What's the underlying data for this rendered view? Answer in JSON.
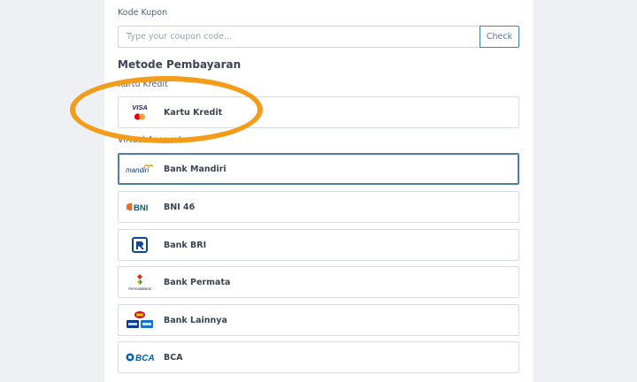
{
  "coupon": {
    "label": "Kode Kupon",
    "placeholder": "Type your coupon code...",
    "value": "",
    "check_label": "Check"
  },
  "payment": {
    "title": "Metode Pembayaran",
    "credit_card_section": "Kartu Kredit",
    "virtual_account_section": "Virtual Account",
    "credit_card": {
      "label": "Kartu Kredit",
      "logo_text": "VISA"
    },
    "banks": [
      {
        "label": "Bank Mandiri",
        "logo_text": "mandiri",
        "selected": true
      },
      {
        "label": "BNI 46",
        "logo_text": "BNI",
        "selected": false
      },
      {
        "label": "Bank BRI",
        "logo_text": "",
        "selected": false
      },
      {
        "label": "Bank Permata",
        "logo_text": "PermataBank",
        "selected": false
      },
      {
        "label": "Bank Lainnya",
        "logo_text": "",
        "selected": false
      },
      {
        "label": "BCA",
        "logo_text": "BCA",
        "selected": false
      }
    ]
  },
  "colors": {
    "accent": "#3f7fb0",
    "highlight": "#f39c1a",
    "selected_border": "#4d7fa6"
  }
}
